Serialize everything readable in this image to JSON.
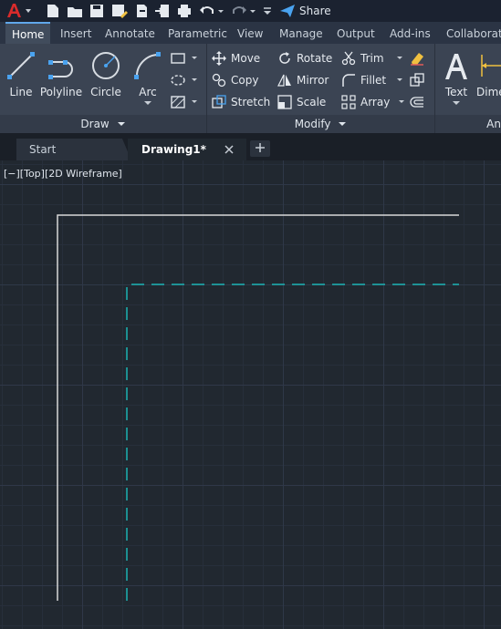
{
  "quick_access": {
    "share_label": "Share"
  },
  "ribbon_tabs": [
    "Home",
    "Insert",
    "Annotate",
    "Parametric",
    "View",
    "Manage",
    "Output",
    "Add-ins",
    "Collaborate"
  ],
  "draw_panel": {
    "title": "Draw",
    "tools": [
      "Line",
      "Polyline",
      "Circle",
      "Arc"
    ]
  },
  "modify_panel": {
    "title": "Modify",
    "rows": [
      [
        "Move",
        "Rotate",
        "Trim"
      ],
      [
        "Copy",
        "Mirror",
        "Fillet"
      ],
      [
        "Stretch",
        "Scale",
        "Array"
      ]
    ]
  },
  "annotation_panel": {
    "title": "An",
    "tools": [
      "Text",
      "Dime"
    ]
  },
  "doc_tabs": {
    "start": "Start",
    "active": "Drawing1*"
  },
  "viewport": {
    "label": "[−][Top][2D Wireframe]"
  },
  "colors": {
    "accent": "#61a8ea",
    "dashed_line": "#1bb3b3",
    "solid_line": "#d8d8d8",
    "logo_red": "#d92b2b"
  }
}
